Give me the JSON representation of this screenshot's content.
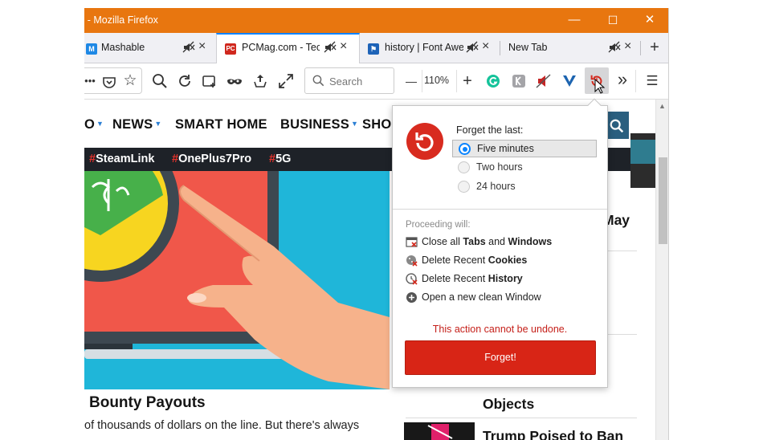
{
  "window": {
    "title": "s - Mozilla Firefox",
    "minimize": "—",
    "maximize": "☐",
    "close": "✕"
  },
  "tabs": [
    {
      "label": "Mashable",
      "favicon_text": "M",
      "favicon_color": "#1e88e5"
    },
    {
      "label": "PCMag.com - Tech",
      "favicon_text": "PC",
      "favicon_color": "#d0281e"
    },
    {
      "label": "history | Font Awes",
      "favicon_text": "⚑",
      "favicon_color": "#1e63b8"
    },
    {
      "label": "New Tab"
    }
  ],
  "toolbar": {
    "search_placeholder": "Search",
    "zoom": "110%",
    "zoom_out": "—",
    "zoom_in": "+",
    "overflow": "»",
    "menu": "☰"
  },
  "site": {
    "nav": [
      "O",
      "NEWS",
      "SMART HOME",
      "BUSINESS",
      "SHOP"
    ],
    "tags": [
      "SteamLink",
      "OnePlus7Pro",
      "5G"
    ],
    "headline": "Bounty Payouts",
    "subline": "of thousands of dollars on the line. But there's always",
    "right_items": [
      "May",
      "Objects",
      "Trump Poised to Ban"
    ]
  },
  "forget_panel": {
    "heading": "Forget the last:",
    "options": [
      "Five minutes",
      "Two hours",
      "24 hours"
    ],
    "selected": "Five minutes",
    "proceeding_label": "Proceeding will:",
    "actions": [
      {
        "pre": "Close all ",
        "b1": "Tabs",
        "mid": " and ",
        "b2": "Windows"
      },
      {
        "pre": "Delete Recent ",
        "b1": "Cookies",
        "mid": "",
        "b2": ""
      },
      {
        "pre": "Delete Recent ",
        "b1": "History",
        "mid": "",
        "b2": ""
      },
      {
        "pre": "Open a new clean Window",
        "b1": "",
        "mid": "",
        "b2": ""
      }
    ],
    "warning": "This action cannot be undone.",
    "button": "Forget!"
  },
  "colors": {
    "titlebar": "#e8760f",
    "accent": "#0a84ff",
    "forget_red": "#d82516",
    "tagbar": "#1e2228",
    "hero_bg": "#1fb6d9"
  }
}
